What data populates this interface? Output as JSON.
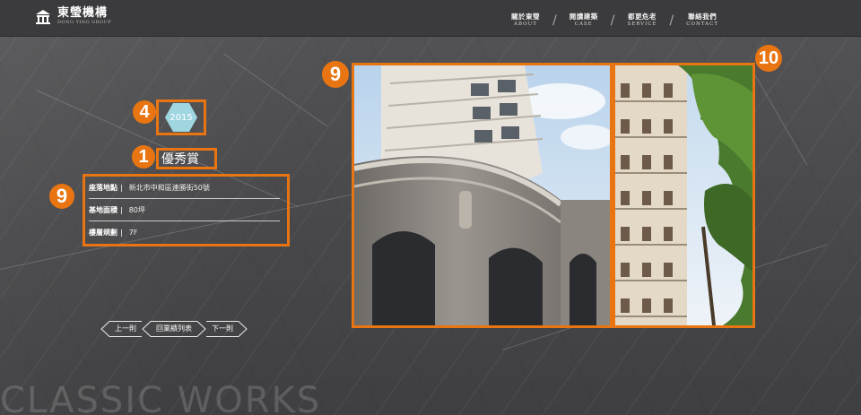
{
  "header": {
    "logo_cn": "東瑩機構",
    "logo_en": "DONG YING GROUP",
    "nav": [
      {
        "cn": "關於東瑩",
        "en": "ABOUT"
      },
      {
        "cn": "閱讀建築",
        "en": "CASE"
      },
      {
        "cn": "都更危老",
        "en": "SERVICE"
      },
      {
        "cn": "聯絡我們",
        "en": "CONTACT"
      }
    ],
    "nav_separator": "/"
  },
  "project": {
    "year": "2015",
    "title": "優秀賞",
    "info": [
      {
        "label": "座落地點",
        "sep": "|",
        "value": "新北市中和區連勝街50號"
      },
      {
        "label": "基地面積",
        "sep": "|",
        "value": "80坪"
      },
      {
        "label": "樓層規劃",
        "sep": "|",
        "value": "7F"
      }
    ]
  },
  "pager": {
    "prev": "上一則",
    "list": "回業績列表",
    "next": "下一則"
  },
  "annotations": {
    "year_badge": "4",
    "title_badge": "1",
    "info_badge": "9",
    "photo_main_badge": "9",
    "photo_side_badge": "10"
  },
  "footer_text": "CLASSIC WORKS",
  "colors": {
    "highlight": "#e87511",
    "year_hex": "#9fd6e0",
    "background": "#4b4b4d",
    "header": "#3b3b3d"
  },
  "icons": {
    "logo": "building-logo-icon",
    "prev_arrow": "chevron-left-icon",
    "next_arrow": "chevron-right-icon"
  }
}
